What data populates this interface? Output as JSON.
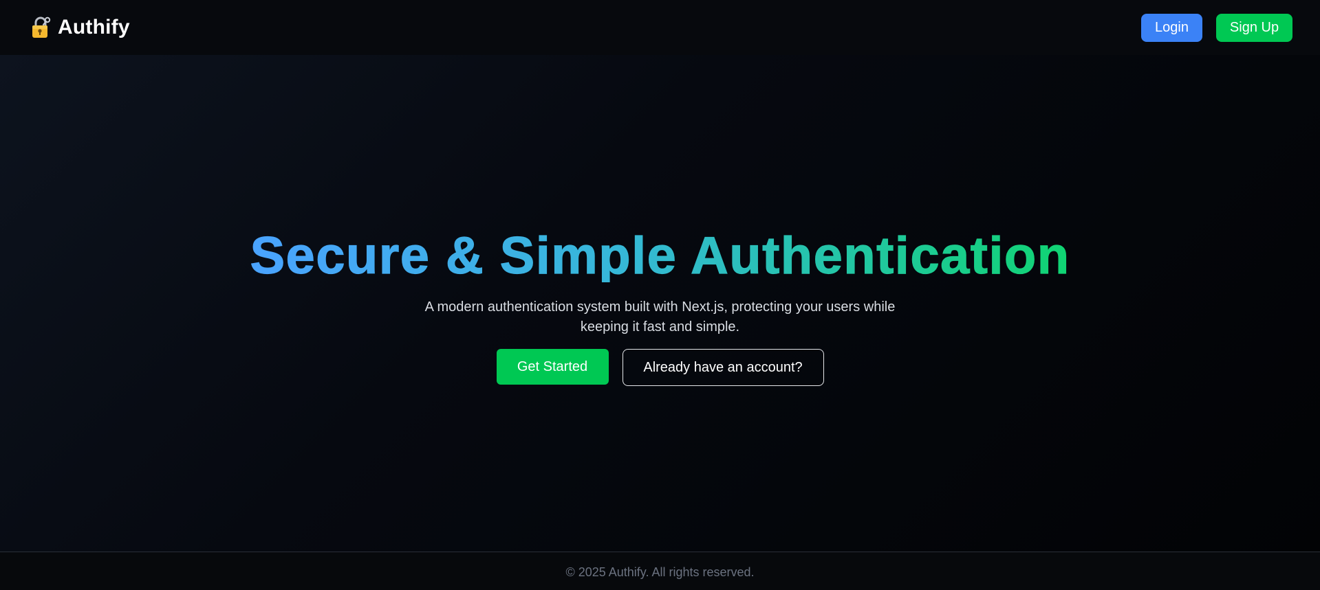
{
  "brand": {
    "name": "Authify",
    "icon": "lock-with-key-icon"
  },
  "nav": {
    "login_label": "Login",
    "signup_label": "Sign Up"
  },
  "hero": {
    "title": "Secure & Simple Authentication",
    "subtitle": "A modern authentication system built with Next.js, protecting your users while keeping it fast and simple.",
    "primary_cta": "Get Started",
    "secondary_cta": "Already have an account?"
  },
  "footer": {
    "copyright": "© 2025 Authify. All rights reserved."
  },
  "colors": {
    "login_button": "#3b82f6",
    "signup_button": "#00c853",
    "title_gradient_start": "#4aa3ff",
    "title_gradient_end": "#10d472",
    "background": "#030406"
  }
}
